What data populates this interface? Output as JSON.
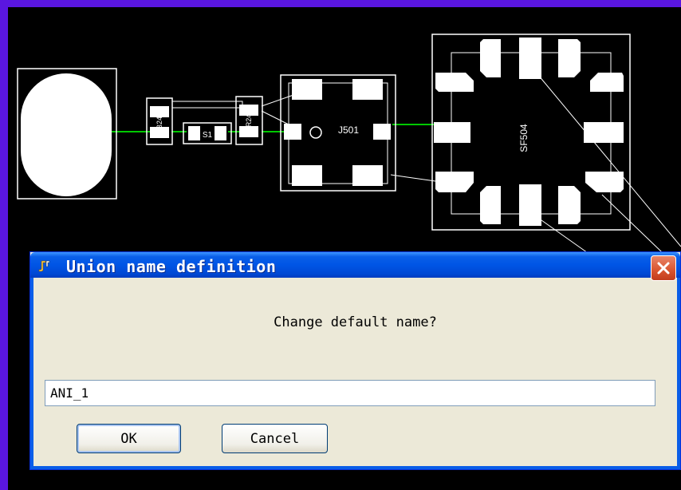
{
  "dialog": {
    "title": "Union name definition",
    "prompt": "Change default name?",
    "input_value": "ANI_1",
    "ok_label": "OK",
    "cancel_label": "Cancel"
  },
  "pcb": {
    "labels": {
      "j501": "J501",
      "sf504": "SF504",
      "small_a": "B24",
      "small_b": "S1",
      "small_c": "R24"
    }
  },
  "colors": {
    "background": "#000000",
    "outline": "#ffffff",
    "net": "#00c800",
    "titlebar": "#0055e5",
    "close": "#d9542e",
    "dialog_face": "#ece9d8"
  },
  "icons": [
    "app-icon",
    "close-icon"
  ]
}
